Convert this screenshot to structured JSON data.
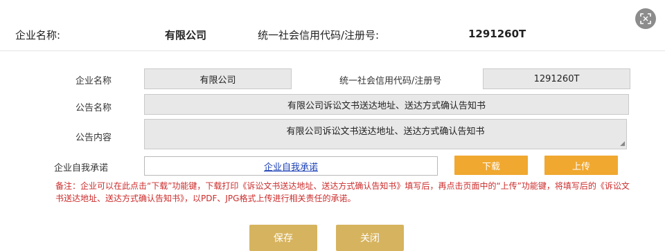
{
  "header": {
    "company_label": "企业名称:",
    "company_value": "有限公司",
    "credit_label": "统一社会信用代码/注册号:",
    "credit_value": "1291260T"
  },
  "form": {
    "company_label": "企业名称",
    "company_value": "有限公司",
    "credit_label": "统一社会信用代码/注册号",
    "credit_value": "1291260T",
    "notice_name_label": "公告名称",
    "notice_name_value": "有限公司诉讼文书送达地址、送达方式确认告知书",
    "notice_content_label": "公告内容",
    "notice_content_value": "有限公司诉讼文书送达地址、送达方式确认告知书",
    "commitment_label": "企业自我承诺",
    "commitment_link": "企业自我承诺"
  },
  "buttons": {
    "download": "下载",
    "upload": "上传",
    "save": "保存",
    "close": "关闭"
  },
  "note": "备注：企业可以在此点击“下载”功能键，下载打印《诉讼文书送达地址、送达方式确认告知书》填写后，再点击页面中的“上传”功能键，将填写后的《诉讼文书送达地址、送达方式确认告知书》，以PDF、JPG格式上传进行相关责任的承诺。",
  "icons": {
    "scan": "scan-icon"
  },
  "colors": {
    "orange": "#f0a830",
    "gold": "#d6b35e",
    "note": "#cc2b2b",
    "link": "#1a3fb5"
  }
}
